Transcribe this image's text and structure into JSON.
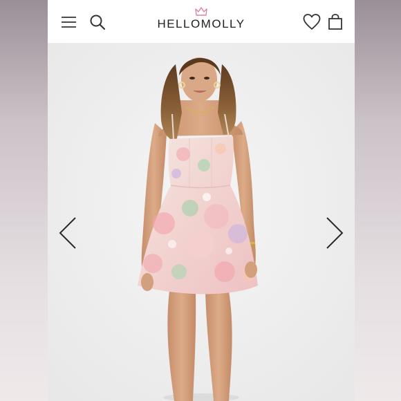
{
  "brand": {
    "logo_text": "HELLOMOLLY"
  },
  "header": {
    "icons": [
      "menu-icon",
      "search-icon",
      "heart-icon",
      "shopping-bag-icon"
    ]
  },
  "product_image": {
    "description_icon": "model-photo",
    "colors": {
      "background": "#eeeeee",
      "dress_base": "#f4ddd9",
      "dress_pink": "#f2a6ad",
      "dress_green": "#9fd0a8",
      "dress_lilac": "#c9b3e0",
      "hair": "#7a5231",
      "skin": "#d4a07e"
    }
  },
  "carousel": {
    "prev_icon": "chevron-left-icon",
    "next_icon": "chevron-right-icon"
  }
}
